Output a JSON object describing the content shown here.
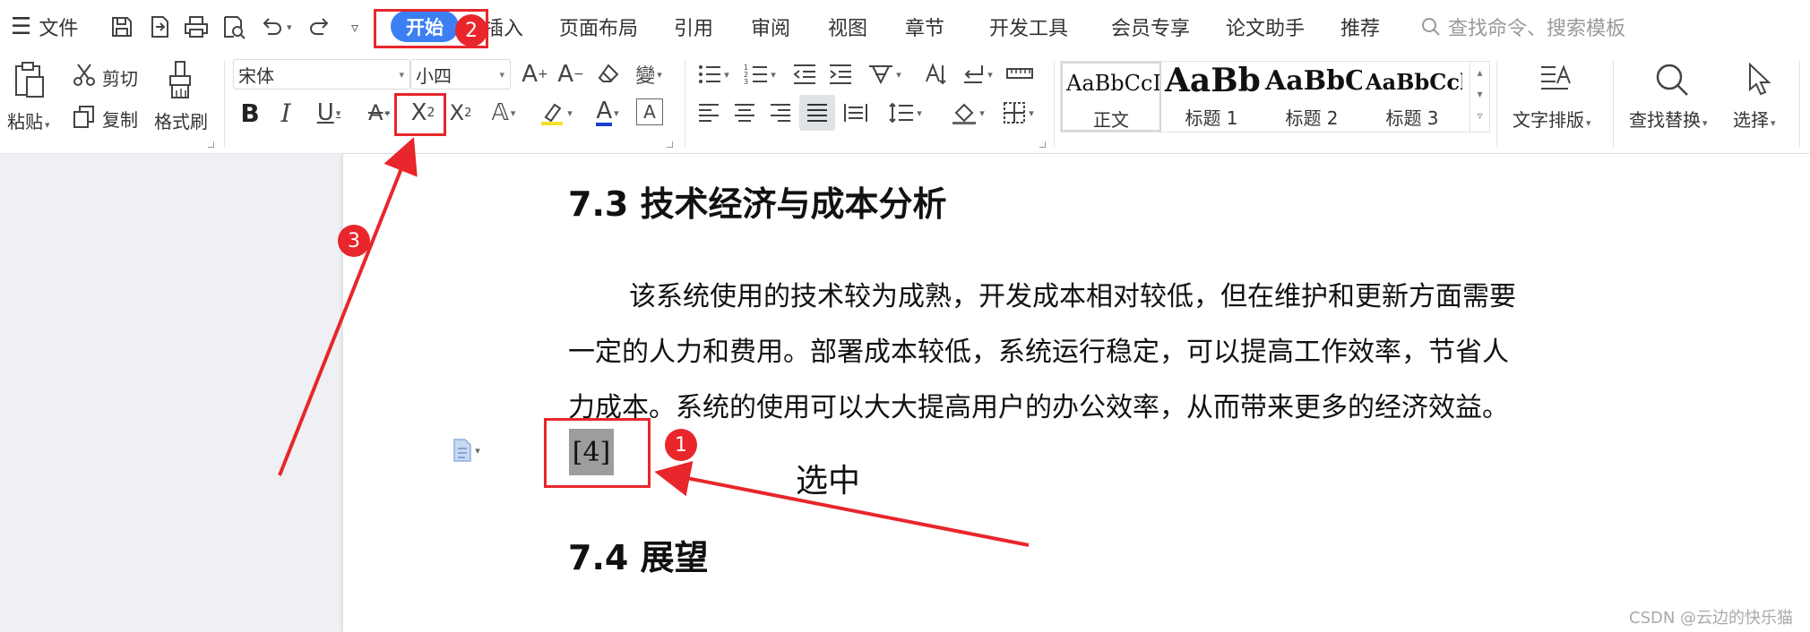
{
  "menubar": {
    "file": "文件",
    "tabs": [
      "开始",
      "插入",
      "页面布局",
      "引用",
      "审阅",
      "视图",
      "章节",
      "开发工具",
      "会员专享",
      "论文助手",
      "推荐"
    ],
    "search_placeholder": "查找命令、搜索模板"
  },
  "ribbon": {
    "clipboard": {
      "paste": "粘贴",
      "cut": "剪切",
      "copy": "复制",
      "format_painter": "格式刷"
    },
    "font": {
      "name": "宋体",
      "size": "小四"
    },
    "styles": [
      {
        "preview": "AaBbCcDd",
        "name": "正文"
      },
      {
        "preview": "AaBb",
        "name": "标题 1"
      },
      {
        "preview": "AaBbC",
        "name": "标题 2"
      },
      {
        "preview": "AaBbCcl",
        "name": "标题 3"
      }
    ],
    "text_layout": "文字排版",
    "find_replace": "查找替换",
    "select": "选择"
  },
  "document": {
    "heading1": "7.3  技术经济与成本分析",
    "para_lines": [
      "该系统使用的技术较为成熟，开发成本相对较低，但在维护和更新方面需要",
      "一定的人力和费用。部署成本较低，系统运行稳定，可以提高工作效率，节省人",
      "力成本。系统的使用可以大大提高用户的办公效率，从而带来更多的经济效益。"
    ],
    "reference": "[4]",
    "heading2": "7.4  展望",
    "annotation_text": "选中",
    "badges": [
      "1",
      "2",
      "3"
    ],
    "watermark": "CSDN @云边的快乐猫"
  },
  "colors": {
    "accent": "#3b7ff2",
    "annotation_red": "#e8262b",
    "selection_gray": "#9d9d9d"
  }
}
